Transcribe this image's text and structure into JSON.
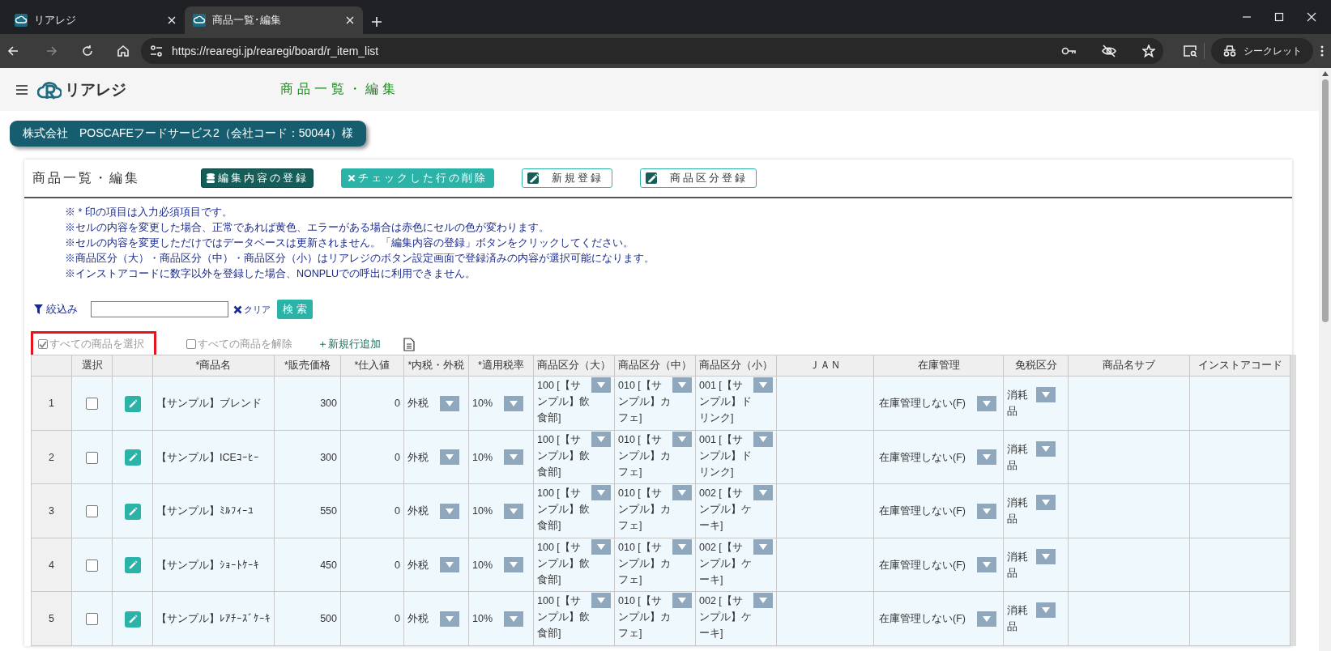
{
  "browser": {
    "tabs": [
      {
        "title": "リアレジ",
        "selected": false
      },
      {
        "title": "商品一覧･編集",
        "selected": true
      }
    ],
    "url": "https://rearegi.jp/rearegi/board/r_item_list",
    "incognito_label": "シークレット"
  },
  "header": {
    "logo_text": "リアレジ",
    "page_title": "商品一覧・編集"
  },
  "company": "株式会社　POSCAFEフードサービス2（会社コード：50044）様",
  "card": {
    "title": "商品一覧・編集",
    "buttons": [
      {
        "label": "編集内容の登録",
        "kind": "save"
      },
      {
        "label": "チェックした行の削除",
        "kind": "delete"
      },
      {
        "label": "新規登録",
        "kind": "outline"
      },
      {
        "label": "商品区分登録",
        "kind": "outline"
      }
    ],
    "notes": [
      "※ * 印の項目は入力必須項目です。",
      "※セルの内容を変更した場合、正常であれば黄色、エラーがある場合は赤色にセルの色が変わります。",
      "※セルの内容を変更しただけではデータベースは更新されません。「編集内容の登録」ボタンをクリックしてください。",
      "※商品区分（大）・商品区分（中）・商品区分（小）はリアレジのボタン設定画面で登録済みの内容が選択可能になります。",
      "※インストアコードに数字以外を登録した場合、NONPLUでの呼出に利用できません。"
    ],
    "filter": {
      "label": "絞込み",
      "clear": "クリア",
      "search": "検 索"
    },
    "select_actions": [
      {
        "label": "すべての商品を選択",
        "checked": true,
        "highlighted": true
      },
      {
        "label": "すべての商品を解除",
        "checked": false,
        "highlighted": false
      }
    ],
    "add_row": "＋新規行追加",
    "columns": [
      "選択",
      "*商品名",
      "*販売価格",
      "*仕入値",
      "*内税・外税",
      "*適用税率",
      "商品区分（大）",
      "商品区分（中）",
      "商品区分（小）",
      "ＪＡＮ",
      "在庫管理",
      "免税区分",
      "商品名サブ",
      "インストアコード"
    ],
    "rows": [
      {
        "no": "1",
        "checked": false,
        "name": "【サンプル】ブレンド",
        "price": "300",
        "cost": "0",
        "tax_type": "外税",
        "tax_rate": "10%",
        "category_large": "100 [【サンプル】飲食部]",
        "category_mid": "010 [【サンプル】カフェ]",
        "category_small": "001 [【サンプル】ドリンク]",
        "stock": "在庫管理しない(F)",
        "duty_free": "消耗品"
      },
      {
        "no": "2",
        "checked": false,
        "name": "【サンプル】ICEｺｰﾋｰ",
        "price": "300",
        "cost": "0",
        "tax_type": "外税",
        "tax_rate": "10%",
        "category_large": "100 [【サンプル】飲食部]",
        "category_mid": "010 [【サンプル】カフェ]",
        "category_small": "001 [【サンプル】ドリンク]",
        "stock": "在庫管理しない(F)",
        "duty_free": "消耗品"
      },
      {
        "no": "3",
        "checked": false,
        "name": "【サンプル】ﾐﾙﾌｨｰﾕ",
        "price": "550",
        "cost": "0",
        "tax_type": "外税",
        "tax_rate": "10%",
        "category_large": "100 [【サンプル】飲食部]",
        "category_mid": "010 [【サンプル】カフェ]",
        "category_small": "002 [【サンプル】ケーキ]",
        "stock": "在庫管理しない(F)",
        "duty_free": "消耗品"
      },
      {
        "no": "4",
        "checked": false,
        "name": "【サンプル】ｼｮｰﾄｹｰｷ",
        "price": "450",
        "cost": "0",
        "tax_type": "外税",
        "tax_rate": "10%",
        "category_large": "100 [【サンプル】飲食部]",
        "category_mid": "010 [【サンプル】カフェ]",
        "category_small": "002 [【サンプル】ケーキ]",
        "stock": "在庫管理しない(F)",
        "duty_free": "消耗品"
      },
      {
        "no": "5",
        "checked": false,
        "name": "【サンプル】ﾚｱﾁｰｽﾞｹｰｷ",
        "price": "500",
        "cost": "0",
        "tax_type": "外税",
        "tax_rate": "10%",
        "category_large": "100 [【サンプル】飲食部]",
        "category_mid": "010 [【サンプル】カフェ]",
        "category_small": "002 [【サンプル】ケーキ]",
        "stock": "在庫管理しない(F)",
        "duty_free": "消耗品"
      }
    ]
  }
}
